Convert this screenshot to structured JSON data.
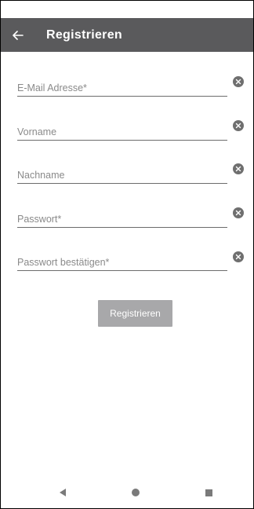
{
  "app_bar": {
    "title": "Registrieren",
    "back_icon": "arrow-left-icon"
  },
  "form": {
    "fields": [
      {
        "placeholder": "E-Mail Adresse*",
        "value": "",
        "clear_icon": "clear-circle-icon"
      },
      {
        "placeholder": "Vorname",
        "value": "",
        "clear_icon": "clear-circle-icon"
      },
      {
        "placeholder": "Nachname",
        "value": "",
        "clear_icon": "clear-circle-icon"
      },
      {
        "placeholder": "Passwort*",
        "value": "",
        "clear_icon": "clear-circle-icon"
      },
      {
        "placeholder": "Passwort bestätigen*",
        "value": "",
        "clear_icon": "clear-circle-icon"
      }
    ],
    "submit_label": "Registrieren"
  },
  "nav_bar": {
    "back_icon": "nav-back-triangle-icon",
    "home_icon": "nav-home-circle-icon",
    "recents_icon": "nav-recents-square-icon"
  },
  "colors": {
    "app_bar": "#5a5a5c",
    "button": "#a8a8aa",
    "underline": "#6c6c6c",
    "clear_icon": "#6f6f6f"
  }
}
